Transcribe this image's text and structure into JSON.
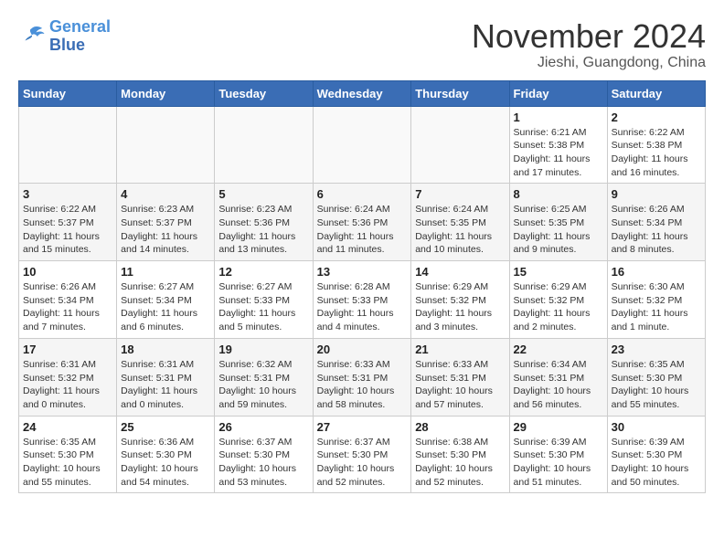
{
  "header": {
    "logo_line1": "General",
    "logo_line2": "Blue",
    "month": "November 2024",
    "location": "Jieshi, Guangdong, China"
  },
  "weekdays": [
    "Sunday",
    "Monday",
    "Tuesday",
    "Wednesday",
    "Thursday",
    "Friday",
    "Saturday"
  ],
  "weeks": [
    [
      {
        "day": "",
        "info": ""
      },
      {
        "day": "",
        "info": ""
      },
      {
        "day": "",
        "info": ""
      },
      {
        "day": "",
        "info": ""
      },
      {
        "day": "",
        "info": ""
      },
      {
        "day": "1",
        "info": "Sunrise: 6:21 AM\nSunset: 5:38 PM\nDaylight: 11 hours and 17 minutes."
      },
      {
        "day": "2",
        "info": "Sunrise: 6:22 AM\nSunset: 5:38 PM\nDaylight: 11 hours and 16 minutes."
      }
    ],
    [
      {
        "day": "3",
        "info": "Sunrise: 6:22 AM\nSunset: 5:37 PM\nDaylight: 11 hours and 15 minutes."
      },
      {
        "day": "4",
        "info": "Sunrise: 6:23 AM\nSunset: 5:37 PM\nDaylight: 11 hours and 14 minutes."
      },
      {
        "day": "5",
        "info": "Sunrise: 6:23 AM\nSunset: 5:36 PM\nDaylight: 11 hours and 13 minutes."
      },
      {
        "day": "6",
        "info": "Sunrise: 6:24 AM\nSunset: 5:36 PM\nDaylight: 11 hours and 11 minutes."
      },
      {
        "day": "7",
        "info": "Sunrise: 6:24 AM\nSunset: 5:35 PM\nDaylight: 11 hours and 10 minutes."
      },
      {
        "day": "8",
        "info": "Sunrise: 6:25 AM\nSunset: 5:35 PM\nDaylight: 11 hours and 9 minutes."
      },
      {
        "day": "9",
        "info": "Sunrise: 6:26 AM\nSunset: 5:34 PM\nDaylight: 11 hours and 8 minutes."
      }
    ],
    [
      {
        "day": "10",
        "info": "Sunrise: 6:26 AM\nSunset: 5:34 PM\nDaylight: 11 hours and 7 minutes."
      },
      {
        "day": "11",
        "info": "Sunrise: 6:27 AM\nSunset: 5:34 PM\nDaylight: 11 hours and 6 minutes."
      },
      {
        "day": "12",
        "info": "Sunrise: 6:27 AM\nSunset: 5:33 PM\nDaylight: 11 hours and 5 minutes."
      },
      {
        "day": "13",
        "info": "Sunrise: 6:28 AM\nSunset: 5:33 PM\nDaylight: 11 hours and 4 minutes."
      },
      {
        "day": "14",
        "info": "Sunrise: 6:29 AM\nSunset: 5:32 PM\nDaylight: 11 hours and 3 minutes."
      },
      {
        "day": "15",
        "info": "Sunrise: 6:29 AM\nSunset: 5:32 PM\nDaylight: 11 hours and 2 minutes."
      },
      {
        "day": "16",
        "info": "Sunrise: 6:30 AM\nSunset: 5:32 PM\nDaylight: 11 hours and 1 minute."
      }
    ],
    [
      {
        "day": "17",
        "info": "Sunrise: 6:31 AM\nSunset: 5:32 PM\nDaylight: 11 hours and 0 minutes."
      },
      {
        "day": "18",
        "info": "Sunrise: 6:31 AM\nSunset: 5:31 PM\nDaylight: 11 hours and 0 minutes."
      },
      {
        "day": "19",
        "info": "Sunrise: 6:32 AM\nSunset: 5:31 PM\nDaylight: 10 hours and 59 minutes."
      },
      {
        "day": "20",
        "info": "Sunrise: 6:33 AM\nSunset: 5:31 PM\nDaylight: 10 hours and 58 minutes."
      },
      {
        "day": "21",
        "info": "Sunrise: 6:33 AM\nSunset: 5:31 PM\nDaylight: 10 hours and 57 minutes."
      },
      {
        "day": "22",
        "info": "Sunrise: 6:34 AM\nSunset: 5:31 PM\nDaylight: 10 hours and 56 minutes."
      },
      {
        "day": "23",
        "info": "Sunrise: 6:35 AM\nSunset: 5:30 PM\nDaylight: 10 hours and 55 minutes."
      }
    ],
    [
      {
        "day": "24",
        "info": "Sunrise: 6:35 AM\nSunset: 5:30 PM\nDaylight: 10 hours and 55 minutes."
      },
      {
        "day": "25",
        "info": "Sunrise: 6:36 AM\nSunset: 5:30 PM\nDaylight: 10 hours and 54 minutes."
      },
      {
        "day": "26",
        "info": "Sunrise: 6:37 AM\nSunset: 5:30 PM\nDaylight: 10 hours and 53 minutes."
      },
      {
        "day": "27",
        "info": "Sunrise: 6:37 AM\nSunset: 5:30 PM\nDaylight: 10 hours and 52 minutes."
      },
      {
        "day": "28",
        "info": "Sunrise: 6:38 AM\nSunset: 5:30 PM\nDaylight: 10 hours and 52 minutes."
      },
      {
        "day": "29",
        "info": "Sunrise: 6:39 AM\nSunset: 5:30 PM\nDaylight: 10 hours and 51 minutes."
      },
      {
        "day": "30",
        "info": "Sunrise: 6:39 AM\nSunset: 5:30 PM\nDaylight: 10 hours and 50 minutes."
      }
    ]
  ]
}
